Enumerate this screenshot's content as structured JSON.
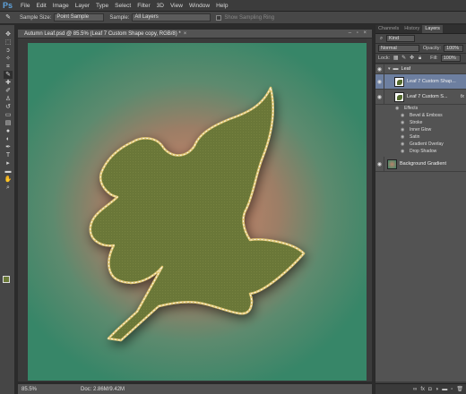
{
  "app": {
    "logo": "Ps"
  },
  "menu": [
    "File",
    "Edit",
    "Image",
    "Layer",
    "Type",
    "Select",
    "Filter",
    "3D",
    "View",
    "Window",
    "Help"
  ],
  "options_bar": {
    "sample_size_label": "Sample Size:",
    "sample_size_value": "Point Sample",
    "sample_label": "Sample:",
    "sample_value": "All Layers",
    "show_ring_label": "Show Sampling Ring"
  },
  "document": {
    "tab_title": "Autumn Leaf.psd @ 85.5% (Leaf 7 Custom Shape copy, RGB/8) *",
    "zoom": "85.5%",
    "doc_info": "Doc: 2.86M/9.42M"
  },
  "colors": {
    "foreground": "#6b7a37",
    "background": "#3f7a57",
    "leaf_fill": "#6e7a3a",
    "leaf_stroke": "#e8cf7a"
  },
  "panel": {
    "tabs": [
      "Channels",
      "History",
      "Layers"
    ],
    "active_tab": "Layers",
    "kind_label": "Kind",
    "blend_mode": "Normal",
    "opacity_label": "Opacity:",
    "opacity_value": "100%",
    "lock_label": "Lock:",
    "fill_label": "Fill:",
    "fill_value": "100%",
    "group_name": "Leaf",
    "layers": [
      {
        "name": "Leaf 7 Custom Shap...",
        "selected": true
      },
      {
        "name": "Leaf 7 Custom S...",
        "fx": "fx"
      }
    ],
    "effects_label": "Effects",
    "effects": [
      "Bevel & Emboss",
      "Stroke",
      "Inner Glow",
      "Satin",
      "Gradient Overlay",
      "Drop Shadow"
    ],
    "background_layer": "Background Gradient"
  },
  "tools": [
    "move-icon",
    "marquee-icon",
    "lasso-icon",
    "quick-select-icon",
    "crop-icon",
    "eyedropper-icon",
    "healing-icon",
    "brush-icon",
    "stamp-icon",
    "history-brush-icon",
    "eraser-icon",
    "gradient-icon",
    "blur-icon",
    "dodge-icon",
    "pen-icon",
    "type-icon",
    "path-select-icon",
    "shape-icon",
    "hand-icon",
    "zoom-icon"
  ]
}
